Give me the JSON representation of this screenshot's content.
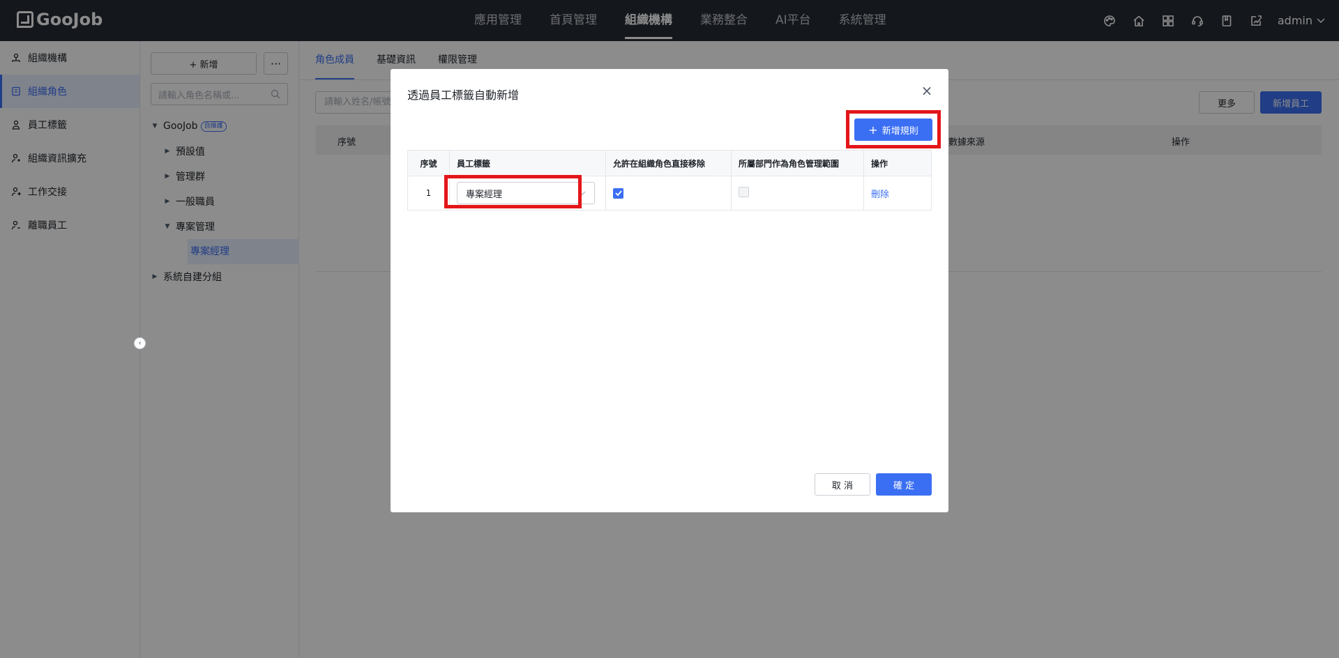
{
  "brand": {
    "logo_text": "GooJob"
  },
  "topnav": {
    "items": [
      {
        "label": "應用管理"
      },
      {
        "label": "首頁管理"
      },
      {
        "label": "組織機構"
      },
      {
        "label": "業務整合"
      },
      {
        "label": "AI平台"
      },
      {
        "label": "系統管理"
      }
    ],
    "active_index": 2
  },
  "topbar": {
    "user": "admin"
  },
  "sidebar": {
    "items": [
      {
        "label": "組織機構",
        "icon": "org-icon"
      },
      {
        "label": "組織角色",
        "icon": "role-icon"
      },
      {
        "label": "員工標籤",
        "icon": "tag-icon"
      },
      {
        "label": "組織資訊擴充",
        "icon": "user-icon"
      },
      {
        "label": "工作交接",
        "icon": "handover-icon"
      },
      {
        "label": "離職員工",
        "icon": "user-leave-icon"
      }
    ],
    "active_index": 1
  },
  "tree_panel": {
    "add_label": "+ 新增",
    "more_label": "···",
    "search_placeholder": "請輸入角色名稱或...",
    "root": {
      "label": "GooJob",
      "badge": "自維護"
    },
    "nodes": [
      {
        "label": "預設值"
      },
      {
        "label": "管理群"
      },
      {
        "label": "一般職員"
      },
      {
        "label": "專案管理"
      },
      {
        "label": "專案經理"
      },
      {
        "label": "系統自建分組"
      }
    ]
  },
  "main": {
    "tabs": [
      {
        "label": "角色成員"
      },
      {
        "label": "基礎資訊"
      },
      {
        "label": "權限管理"
      }
    ],
    "active_tab": 0,
    "search_placeholder": "請輸入姓名/帳號",
    "more_label": "更多",
    "new_employee_label": "新增員工",
    "columns": {
      "index": "序號",
      "source": "數據來源",
      "action": "操作"
    }
  },
  "modal": {
    "title": "透過員工標籤自動新增",
    "add_rule_label": "新增規則",
    "columns": {
      "index": "序號",
      "tag": "員工標籤",
      "allow_remove": "允許在組織角色直接移除",
      "dept_scope": "所屬部門作為角色管理範圍",
      "action": "操作"
    },
    "rows": [
      {
        "index": "1",
        "tag": "專案經理",
        "allow_remove": true,
        "dept_scope": false,
        "action": "刪除"
      }
    ],
    "cancel_label": "取 消",
    "ok_label": "確 定"
  },
  "colors": {
    "primary": "#3b6ff3",
    "topbar": "#252a33",
    "highlight": "#e4161a"
  }
}
